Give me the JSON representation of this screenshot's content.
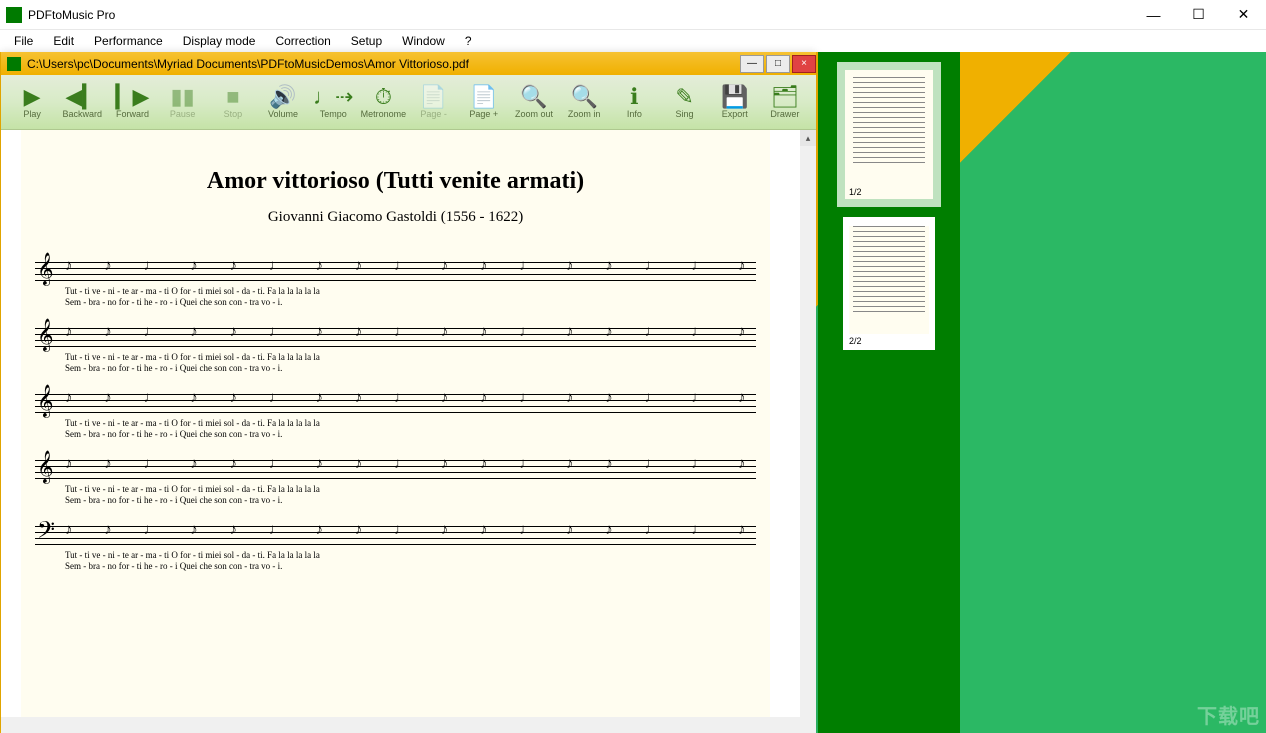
{
  "app": {
    "title": "PDFtoMusic Pro"
  },
  "window_controls": {
    "minimize": "—",
    "maximize": "☐",
    "close": "✕"
  },
  "menus": [
    "File",
    "Edit",
    "Performance",
    "Display mode",
    "Correction",
    "Setup",
    "Window",
    "?"
  ],
  "document": {
    "path": "C:\\Users\\pc\\Documents\\Myriad Documents\\PDFtoMusicDemos\\Amor Vittorioso.pdf",
    "close": "×",
    "min": "—",
    "max": "□"
  },
  "toolbar": [
    {
      "id": "play",
      "label": "Play",
      "glyph": "▶",
      "en": true
    },
    {
      "id": "backward",
      "label": "Backward",
      "glyph": "◀▎",
      "en": true
    },
    {
      "id": "forward",
      "label": "Forward",
      "glyph": "▎▶",
      "en": true
    },
    {
      "id": "pause",
      "label": "Pause",
      "glyph": "▮▮",
      "en": false
    },
    {
      "id": "stop",
      "label": "Stop",
      "glyph": "■",
      "en": false
    },
    {
      "id": "volume",
      "label": "Volume",
      "glyph": "🔊",
      "en": true
    },
    {
      "id": "tempo",
      "label": "Tempo",
      "glyph": "♩⇢",
      "en": true
    },
    {
      "id": "metronome",
      "label": "Metronome",
      "glyph": "⏱",
      "en": true
    },
    {
      "id": "page-minus",
      "label": "Page -",
      "glyph": "📄",
      "en": false
    },
    {
      "id": "page-plus",
      "label": "Page +",
      "glyph": "📄",
      "en": true
    },
    {
      "id": "zoom-out",
      "label": "Zoom out",
      "glyph": "🔍",
      "en": true
    },
    {
      "id": "zoom-in",
      "label": "Zoom in",
      "glyph": "🔍",
      "en": true
    },
    {
      "id": "info",
      "label": "Info",
      "glyph": "ℹ",
      "en": true
    },
    {
      "id": "sing",
      "label": "Sing",
      "glyph": "✎",
      "en": true
    },
    {
      "id": "export",
      "label": "Export",
      "glyph": "💾",
      "en": true
    },
    {
      "id": "drawer",
      "label": "Drawer",
      "glyph": "🗂",
      "en": true
    }
  ],
  "score": {
    "title": "Amor vittorioso (Tutti venite armati)",
    "composer": "Giovanni Giacomo Gastoldi (1556 - 1622)",
    "notes_row": "♪ ♪ ♩  ♪ ♪ ♩  ♪ ♪ ♩  ♪ ♪ ♩  ♪ ♪ ♩ ♩  ♪ ♪ ♩ ♩",
    "lyric1": "Tut - ti   ve  - ni - te ar  - ma    -    ti          O    for - ti  miei   sol   -  da    -    ti.           Fa    la    la    la    la    la",
    "lyric2": "Sem - bra - no   for - ti he  - ro    -    i           Quei  che  son  con  - tra     vo    -    i.",
    "staves": [
      {
        "clef": "𝄞"
      },
      {
        "clef": "𝄞"
      },
      {
        "clef": "𝄞"
      },
      {
        "clef": "𝄞"
      },
      {
        "clef": "𝄢"
      }
    ]
  },
  "thumbs": [
    {
      "label": "1/2",
      "selected": true
    },
    {
      "label": "2/2",
      "selected": false
    }
  ],
  "watermark": "下载吧"
}
